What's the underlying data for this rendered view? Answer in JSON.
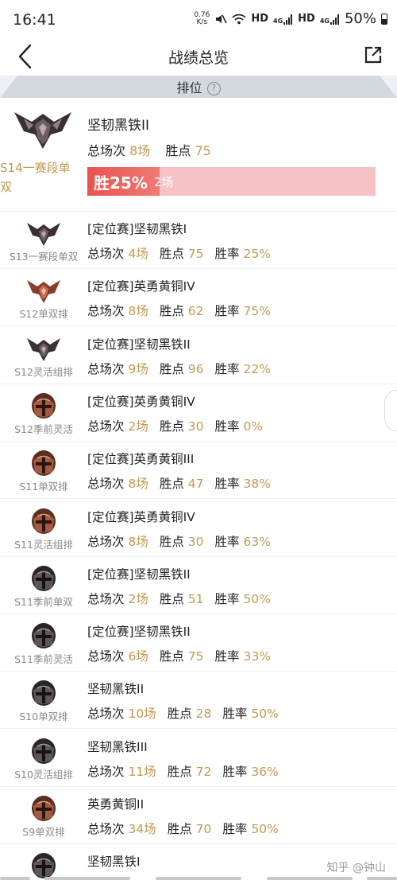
{
  "status_bar": {
    "time": "16:41",
    "speed_value": "0.76",
    "speed_unit": "K/s",
    "hd1": "HD",
    "hd2": "HD",
    "net1": "4G",
    "net2": "4G",
    "battery": "50%",
    "icons": [
      "mute-icon",
      "wifi-icon",
      "signal-icon",
      "battery-icon"
    ]
  },
  "nav": {
    "title": "战绩总览",
    "back_icon": "back-chevron-icon",
    "share_icon": "share-external-icon"
  },
  "tab": {
    "title": "排位",
    "help_glyph": "?"
  },
  "current": {
    "season": "S14一赛段单双",
    "rank": "坚韧黑铁II",
    "games_label": "总场次",
    "games_value": "8场",
    "points_label": "胜点",
    "points_value": "75",
    "win_rate_text": "胜25%",
    "win_rate": 0.25,
    "win_games": "2场",
    "bar_color": "#e8534f",
    "bar_bg": "#f7c2c5"
  },
  "labels": {
    "games": "总场次",
    "points": "胜点",
    "winrate": "胜率"
  },
  "rows": [
    {
      "season": "S13一赛段单双",
      "rank": "[定位赛]坚韧黑铁I",
      "games": "4场",
      "points": "75",
      "winrate": "25%",
      "emblem": "iron-wing"
    },
    {
      "season": "S12单双排",
      "rank": "[定位赛]英勇黄铜IV",
      "games": "8场",
      "points": "62",
      "winrate": "75%",
      "emblem": "bronze-wing"
    },
    {
      "season": "S12灵活组排",
      "rank": "[定位赛]坚韧黑铁II",
      "games": "9场",
      "points": "96",
      "winrate": "22%",
      "emblem": "iron-wing"
    },
    {
      "season": "S12季前灵活",
      "rank": "[定位赛]英勇黄铜IV",
      "games": "2场",
      "points": "30",
      "winrate": "0%",
      "emblem": "bronze-helm"
    },
    {
      "season": "S11单双排",
      "rank": "[定位赛]英勇黄铜III",
      "games": "8场",
      "points": "47",
      "winrate": "38%",
      "emblem": "bronze-helm"
    },
    {
      "season": "S11灵活组排",
      "rank": "[定位赛]英勇黄铜IV",
      "games": "8场",
      "points": "30",
      "winrate": "63%",
      "emblem": "bronze-helm"
    },
    {
      "season": "S11季前单双",
      "rank": "[定位赛]坚韧黑铁II",
      "games": "2场",
      "points": "51",
      "winrate": "50%",
      "emblem": "iron-helm"
    },
    {
      "season": "S11季前灵活",
      "rank": "[定位赛]坚韧黑铁II",
      "games": "6场",
      "points": "75",
      "winrate": "33%",
      "emblem": "iron-helm"
    },
    {
      "season": "S10单双排",
      "rank": "坚韧黑铁II",
      "games": "10场",
      "points": "28",
      "winrate": "50%",
      "emblem": "iron-helm"
    },
    {
      "season": "S10灵活组排",
      "rank": "坚韧黑铁III",
      "games": "11场",
      "points": "72",
      "winrate": "36%",
      "emblem": "iron-helm"
    },
    {
      "season": "S9单双排",
      "rank": "英勇黄铜II",
      "games": "34场",
      "points": "70",
      "winrate": "50%",
      "emblem": "bronze-helm"
    },
    {
      "season": "",
      "rank": "坚韧黑铁I",
      "games": "",
      "points": "",
      "winrate": "",
      "emblem": "iron-helm"
    }
  ],
  "watermark": "知乎 @钟山"
}
